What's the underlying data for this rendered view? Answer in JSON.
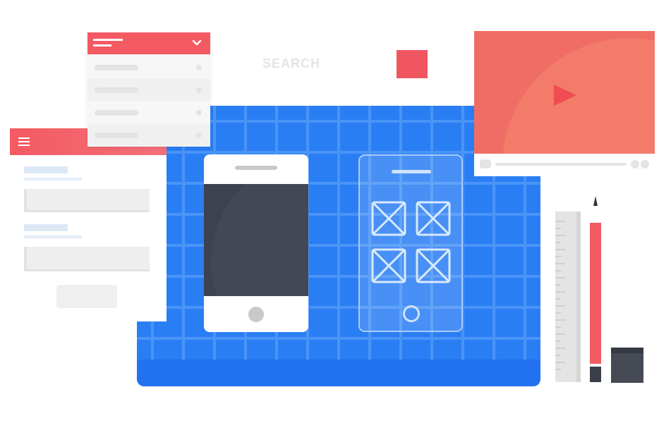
{
  "search": {
    "label": "SEARCH"
  },
  "colors": {
    "accent_red": "#f35a62",
    "blueprint_blue": "#2a7ef4",
    "video_coral": "#f06d65",
    "dark_screen": "#3d4250"
  },
  "icons": {
    "menu": "hamburger-icon",
    "dropdown_toggle": "chevron-down-icon",
    "play": "play-icon",
    "image_placeholder": "image-placeholder-icon"
  }
}
